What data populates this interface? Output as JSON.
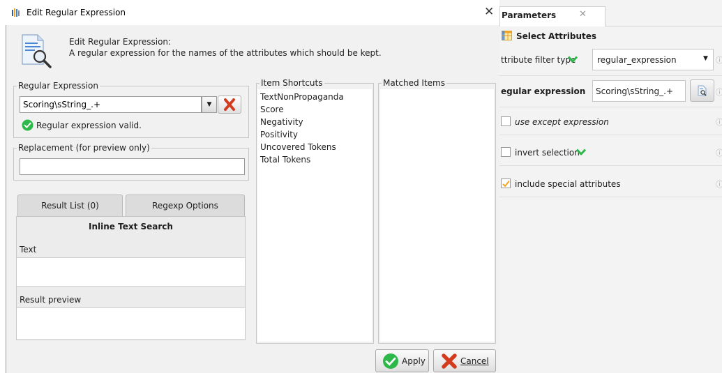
{
  "dialog": {
    "title": "Edit Regular Expression",
    "header_title": "Edit Regular Expression:",
    "header_description": "A regular expression for the names of the attributes which should be kept.",
    "regex_group_label": "Regular Expression",
    "regex_value": "Scoring\\sString_.+",
    "valid_message": "Regular expression valid.",
    "replacement_group_label": "Replacement (for preview only)",
    "replacement_value": "",
    "tabs": [
      {
        "label": "Result List (0)"
      },
      {
        "label": "Regexp Options"
      }
    ],
    "inline_search_heading": "Inline Text Search",
    "text_label": "Text",
    "result_preview_label": "Result preview",
    "item_shortcuts_label": "Item Shortcuts",
    "item_shortcuts": [
      "TextNonPropaganda",
      "Score",
      "Negativity",
      "Positivity",
      "Uncovered Tokens",
      "Total Tokens"
    ],
    "matched_items_label": "Matched Items",
    "apply_label": "Apply",
    "cancel_label": "Cancel",
    "close_glyph": "✕"
  },
  "parameters": {
    "tab_label": "Parameters",
    "tab_close_glyph": "✕",
    "section_label": "Select Attributes",
    "rows": {
      "filter_type_label": "ttribute filter type",
      "filter_type_value": "regular_expression",
      "regex_label": "egular expression",
      "regex_value": "Scoring\\sString_.+",
      "use_except_label": "use except expression",
      "invert_selection_label": "invert selection",
      "include_special_label": "include special attributes"
    },
    "checkboxes": {
      "use_except": false,
      "invert_selection": false,
      "include_special": true
    }
  },
  "colors": {
    "accent_green": "#2db84a",
    "cancel_red": "#d23b1e",
    "panel_bg": "#f1f1f1"
  }
}
